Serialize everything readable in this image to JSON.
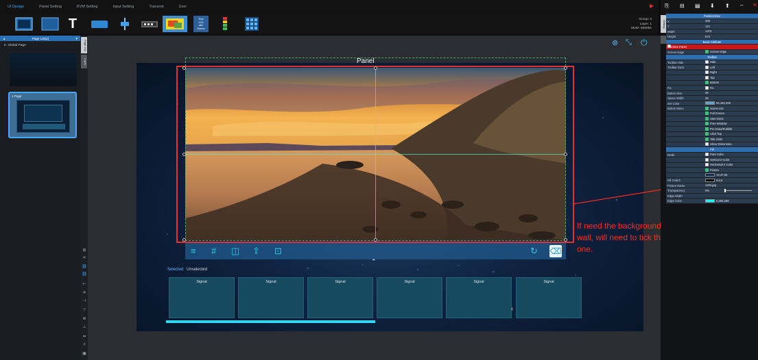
{
  "menu": [
    "UI Design",
    "Panel Setting",
    "KVM Setting",
    "Input Setting",
    "Transmit",
    "User"
  ],
  "group_info": {
    "group": "Group: 0",
    "layer": "Layer: 1",
    "uuid": "UUID: 808081"
  },
  "tool_text_label": "Text\n123\nabc\nScene",
  "left_panel": {
    "header": "Page List(2)",
    "items": [
      {
        "index": "0",
        "label": "Global Page"
      },
      {
        "index": "1",
        "label": "Page"
      }
    ],
    "tabs": [
      "Page List",
      "Layer"
    ]
  },
  "canvas": {
    "panel_title": "Panel",
    "selected_tab": "Selected",
    "unselected_tab": "Unselected",
    "signals": [
      "Signal",
      "Signal",
      "Signal",
      "Signal",
      "Signal",
      "Signal"
    ],
    "annotation": "If need the background image for this video wall, will need to tick this picture box to upload one."
  },
  "right_panel": {
    "side_tab": "Setting",
    "rows": [
      {
        "type": "section",
        "label": "Position/Size"
      },
      {
        "type": "kv",
        "k": "X",
        "v": "329"
      },
      {
        "type": "kv",
        "k": "Y",
        "v": "113"
      },
      {
        "type": "kv",
        "k": "Width",
        "v": "1272"
      },
      {
        "type": "kv",
        "k": "Height",
        "v": "574"
      },
      {
        "type": "section",
        "label": "Basic Attribute"
      },
      {
        "type": "red",
        "k": "Clone Panel",
        "v": ""
      },
      {
        "type": "chk",
        "k": "Screen Edge",
        "v": "Screen Edge",
        "on": true
      },
      {
        "type": "section",
        "label": "Toolbar"
      },
      {
        "type": "chk",
        "k": "Toolbar Hide",
        "v": "Hide",
        "on": false
      },
      {
        "type": "chk",
        "k": "Toolbar Dock",
        "v": "Left",
        "on": false
      },
      {
        "type": "chk",
        "k": "",
        "v": "Right",
        "on": false
      },
      {
        "type": "chk",
        "k": "",
        "v": "Top",
        "on": false
      },
      {
        "type": "chk",
        "k": "",
        "v": "Bottom",
        "on": true
      },
      {
        "type": "chk",
        "k": "Fix",
        "v": "Fix",
        "on": false
      },
      {
        "type": "kv",
        "k": "Button Size",
        "v": "36"
      },
      {
        "type": "kv",
        "k": "Space Width",
        "v": "36"
      },
      {
        "type": "color",
        "k": "Set Color",
        "v": "94,162,205",
        "color": "#5ea2cd"
      },
      {
        "type": "chk",
        "k": "Button Menu",
        "v": "Scene List",
        "on": true
      },
      {
        "type": "chk",
        "k": "",
        "v": "Full Screen",
        "on": true
      },
      {
        "type": "chk",
        "k": "",
        "v": "User Dock",
        "on": true
      },
      {
        "type": "chk",
        "k": "",
        "v": "Free Window",
        "on": true
      },
      {
        "type": "chk",
        "k": "",
        "v": "Pre Draw/Publish",
        "on": true
      },
      {
        "type": "chk",
        "k": "",
        "v": "Click Top",
        "on": true
      },
      {
        "type": "chk",
        "k": "",
        "v": "Title OSD",
        "on": true
      },
      {
        "type": "chk",
        "k": "",
        "v": "Show Dimension",
        "on": false
      },
      {
        "type": "section",
        "label": "Fill"
      },
      {
        "type": "chk",
        "k": "Mode",
        "v": "Pure Color",
        "on": false
      },
      {
        "type": "chk",
        "k": "",
        "v": "Vertical 2 Color",
        "on": false
      },
      {
        "type": "chk",
        "k": "",
        "v": "Horizontal 2 Color",
        "on": false
      },
      {
        "type": "chk",
        "k": "",
        "v": "Picture",
        "on": true
      },
      {
        "type": "color",
        "k": "",
        "v": "13,47,83",
        "color": "#0d2f53"
      },
      {
        "type": "color",
        "k": "Fill Color2",
        "v": "0,0,0",
        "color": "#000000"
      },
      {
        "type": "kv",
        "k": "Picture Name",
        "v": "1234.jpg"
      },
      {
        "type": "slider",
        "k": "Transparency",
        "v": "0%",
        "level": 0
      },
      {
        "type": "kv",
        "k": "Edge Width",
        "v": ""
      },
      {
        "type": "color",
        "k": "Edge Color",
        "v": "0,255,255",
        "color": "#00ffff"
      }
    ]
  }
}
